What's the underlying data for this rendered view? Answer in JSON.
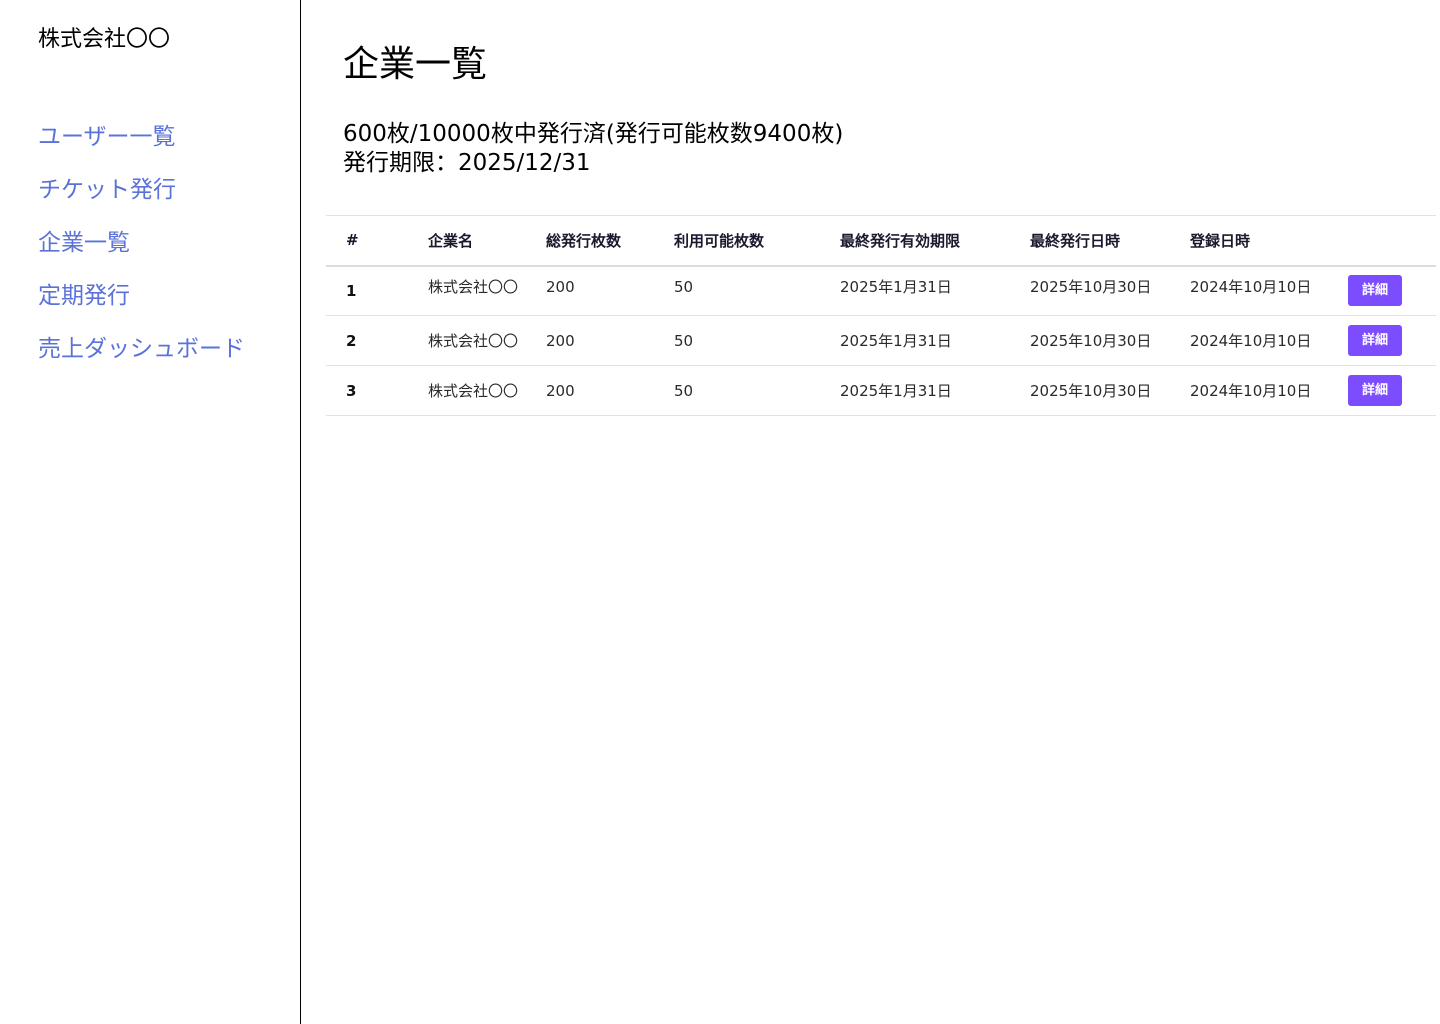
{
  "sidebar": {
    "company_name": "株式会社〇〇",
    "nav_items": [
      {
        "label": "ユーザー一覧"
      },
      {
        "label": "チケット発行"
      },
      {
        "label": "企業一覧"
      },
      {
        "label": "定期発行"
      },
      {
        "label": "売上ダッシュボード"
      }
    ]
  },
  "main": {
    "title": "企業一覧",
    "summary_line1": "600枚/10000枚中発行済(発行可能枚数9400枚)",
    "summary_line2": "発行期限：2025/12/31"
  },
  "table": {
    "headers": [
      "#",
      "企業名",
      "総発行枚数",
      "利用可能枚数",
      "最終発行有効期限",
      "最終発行日時",
      "登録日時",
      ""
    ],
    "rows": [
      {
        "num": "1",
        "company": "株式会社〇〇",
        "total": "200",
        "available": "50",
        "expiry": "2025年1月31日",
        "last_issued": "2025年10月30日",
        "registered": "2024年10月10日",
        "action": "詳細"
      },
      {
        "num": "2",
        "company": "株式会社〇〇",
        "total": "200",
        "available": "50",
        "expiry": "2025年1月31日",
        "last_issued": "2025年10月30日",
        "registered": "2024年10月10日",
        "action": "詳細"
      },
      {
        "num": "3",
        "company": "株式会社〇〇",
        "total": "200",
        "available": "50",
        "expiry": "2025年1月31日",
        "last_issued": "2025年10月30日",
        "registered": "2024年10月10日",
        "action": "詳細"
      }
    ]
  },
  "colors": {
    "nav_link": "#5b72d8",
    "button_bg": "#7c4dff",
    "button_text": "#ffffff",
    "divider": "#000000"
  }
}
